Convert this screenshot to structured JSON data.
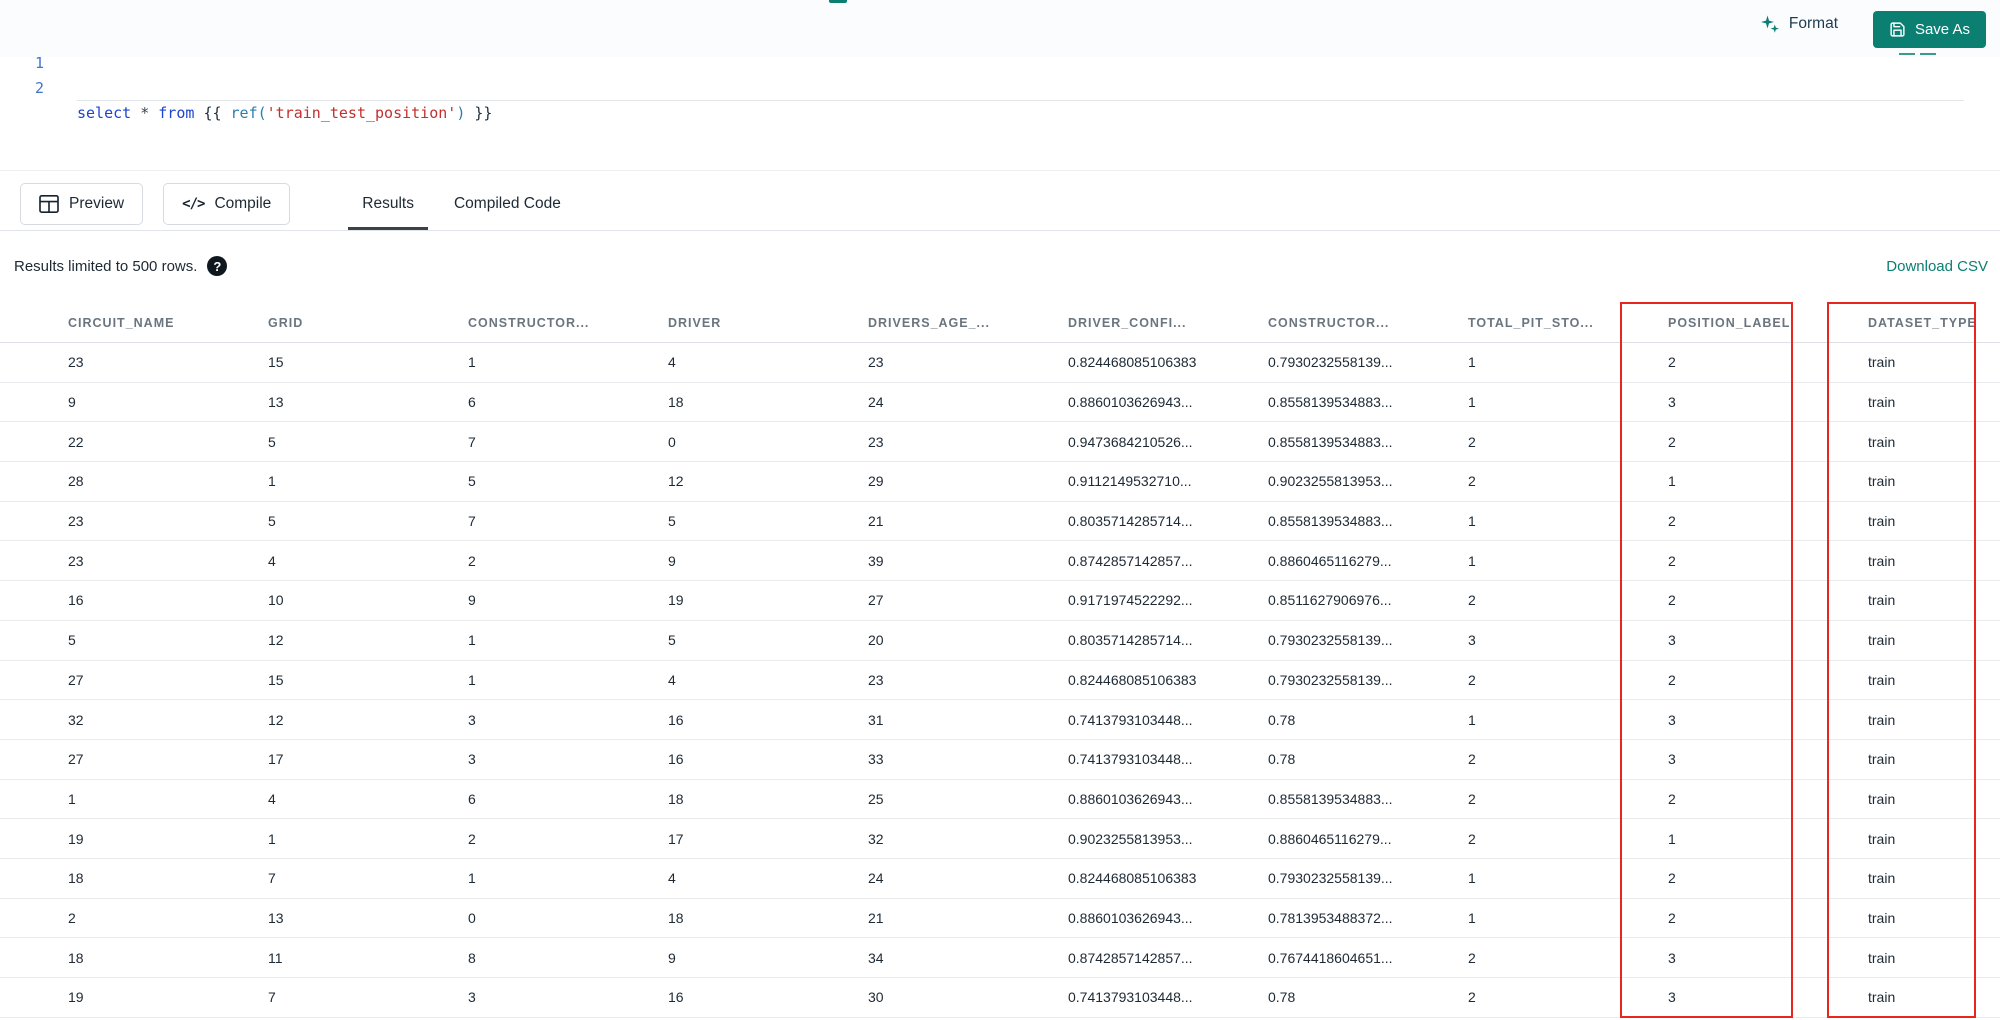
{
  "colors": {
    "accent": "#0b7f72",
    "highlight": "#e8251f"
  },
  "toolbar": {
    "format_label": "Format",
    "save_as_label": "Save As"
  },
  "editor": {
    "line_numbers": [
      "1",
      "2"
    ],
    "tokens": [
      "select ",
      "* ",
      "from ",
      "{{ ",
      "ref(",
      "'train_test_position'",
      ") ",
      "}}"
    ]
  },
  "actions": {
    "preview_label": "Preview",
    "compile_label": "Compile",
    "compile_icon_glyph": "</>"
  },
  "tabs": [
    {
      "label": "Results",
      "active": true
    },
    {
      "label": "Compiled Code",
      "active": false
    }
  ],
  "results_bar": {
    "info": "Results limited to 500 rows.",
    "help_symbol": "?",
    "download_label": "Download CSV"
  },
  "table": {
    "columns": [
      "CIRCUIT_NAME",
      "GRID",
      "CONSTRUCTOR...",
      "DRIVER",
      "DRIVERS_AGE_...",
      "DRIVER_CONFI...",
      "CONSTRUCTOR...",
      "TOTAL_PIT_STO...",
      "POSITION_LABEL",
      "DATASET_TYPE"
    ],
    "rows": [
      [
        "23",
        "15",
        "1",
        "4",
        "23",
        "0.824468085106383",
        "0.7930232558139...",
        "1",
        "2",
        "train"
      ],
      [
        "9",
        "13",
        "6",
        "18",
        "24",
        "0.8860103626943...",
        "0.8558139534883...",
        "1",
        "3",
        "train"
      ],
      [
        "22",
        "5",
        "7",
        "0",
        "23",
        "0.9473684210526...",
        "0.8558139534883...",
        "2",
        "2",
        "train"
      ],
      [
        "28",
        "1",
        "5",
        "12",
        "29",
        "0.9112149532710...",
        "0.9023255813953...",
        "2",
        "1",
        "train"
      ],
      [
        "23",
        "5",
        "7",
        "5",
        "21",
        "0.8035714285714...",
        "0.8558139534883...",
        "1",
        "2",
        "train"
      ],
      [
        "23",
        "4",
        "2",
        "9",
        "39",
        "0.8742857142857...",
        "0.8860465116279...",
        "1",
        "2",
        "train"
      ],
      [
        "16",
        "10",
        "9",
        "19",
        "27",
        "0.9171974522292...",
        "0.8511627906976...",
        "2",
        "2",
        "train"
      ],
      [
        "5",
        "12",
        "1",
        "5",
        "20",
        "0.8035714285714...",
        "0.7930232558139...",
        "3",
        "3",
        "train"
      ],
      [
        "27",
        "15",
        "1",
        "4",
        "23",
        "0.824468085106383",
        "0.7930232558139...",
        "2",
        "2",
        "train"
      ],
      [
        "32",
        "12",
        "3",
        "16",
        "31",
        "0.7413793103448...",
        "0.78",
        "1",
        "3",
        "train"
      ],
      [
        "27",
        "17",
        "3",
        "16",
        "33",
        "0.7413793103448...",
        "0.78",
        "2",
        "3",
        "train"
      ],
      [
        "1",
        "4",
        "6",
        "18",
        "25",
        "0.8860103626943...",
        "0.8558139534883...",
        "2",
        "2",
        "train"
      ],
      [
        "19",
        "1",
        "2",
        "17",
        "32",
        "0.9023255813953...",
        "0.8860465116279...",
        "2",
        "1",
        "train"
      ],
      [
        "18",
        "7",
        "1",
        "4",
        "24",
        "0.824468085106383",
        "0.7930232558139...",
        "1",
        "2",
        "train"
      ],
      [
        "2",
        "13",
        "0",
        "18",
        "21",
        "0.8860103626943...",
        "0.7813953488372...",
        "1",
        "2",
        "train"
      ],
      [
        "18",
        "11",
        "8",
        "9",
        "34",
        "0.8742857142857...",
        "0.7674418604651...",
        "2",
        "3",
        "train"
      ],
      [
        "19",
        "7",
        "3",
        "16",
        "30",
        "0.7413793103448...",
        "0.78",
        "2",
        "3",
        "train"
      ]
    ]
  }
}
